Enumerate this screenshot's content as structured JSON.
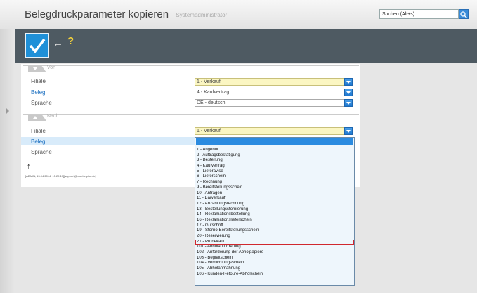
{
  "header": {
    "title": "Belegdruckparameter kopieren",
    "subtitle": "Systemadministrator",
    "search_placeholder": "Suchen (Alt+s)"
  },
  "toolbar": {
    "back_label": "←",
    "help_label": "?"
  },
  "section_von": {
    "label": "Von",
    "rows": [
      {
        "label": "Filiale",
        "value": "1 - Verkauf"
      },
      {
        "label": "Beleg",
        "value": "4 - Kaufvertrag"
      },
      {
        "label": "Sprache",
        "value": "DE - deutsch"
      }
    ]
  },
  "section_nach": {
    "label": "Nach",
    "rows": [
      {
        "label": "Filiale",
        "value": "1 - Verkauf"
      },
      {
        "label": "Beleg",
        "value": ""
      },
      {
        "label": "Sprache",
        "value": ""
      }
    ]
  },
  "footer": {
    "arrow": "↑",
    "info": "[ADMIN, 15.04.2014, 15:29:17][support@moebelpilot.de]"
  },
  "dropdown": {
    "selected_index": 20,
    "options": [
      "1 - Angebot",
      "2 - Auftragsbestätigung",
      "3 - Bestellung",
      "4 - Kaufvertrag",
      "5 - Lieferavise",
      "6 - Lieferschein",
      "7 - Rechnung",
      "9 - Bereitstellungsschein",
      "10 - Anfragen",
      "11 - Barverkauf",
      "12 - Anzahlungsrechnung",
      "13 - Bestellungsstornierung",
      "14 - Reklamationsbestellung",
      "16 - Reklamationslieferschein",
      "17 - Gutschrift",
      "19 - Storno-Bereitstellungsschein",
      "20 - Reservierung",
      "21 - Probekauf",
      "101 - Abholanforderung",
      "102 - Anforderung der Abholpapiere",
      "103 - Begleitschein",
      "104 - Vernichtungsschein",
      "105 - Abholanmahnung",
      "106 - Kunden-Retoure-Abholschein"
    ]
  },
  "colors": {
    "accent": "#1f90d8",
    "toolbar": "#4e5a62",
    "highlight": "#d0282e"
  }
}
